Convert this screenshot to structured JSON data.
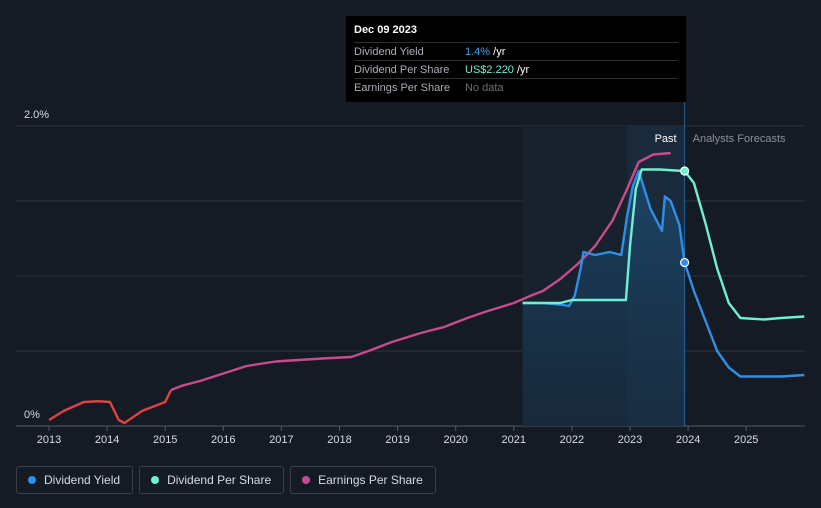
{
  "tooltip": {
    "date": "Dec 09 2023",
    "rows": [
      {
        "label": "Dividend Yield",
        "value": "1.4%",
        "unit": " /yr"
      },
      {
        "label": "Dividend Per Share",
        "value": "US$2.220",
        "unit": " /yr"
      },
      {
        "label": "Earnings Per Share",
        "value": "No data",
        "unit": ""
      }
    ]
  },
  "legend": [
    {
      "label": "Dividend Yield",
      "color": "#2f8fe6"
    },
    {
      "label": "Dividend Per Share",
      "color": "#6ff0d2"
    },
    {
      "label": "Earnings Per Share",
      "color": "#c94b8f"
    }
  ],
  "chart_data": {
    "type": "line",
    "y_tick_labels": [
      "2.0%",
      "0%"
    ],
    "x_tick_labels": [
      "2013",
      "2014",
      "2015",
      "2016",
      "2017",
      "2018",
      "2019",
      "2020",
      "2021",
      "2022",
      "2023",
      "2024",
      "2025"
    ],
    "past_label": "Past",
    "forecast_label": "Analysts Forecasts",
    "ylim": [
      0,
      2.0
    ],
    "xlim": [
      2012.55,
      2026.0
    ],
    "grid": true,
    "past_region": [
      2021.15,
      2023.94
    ],
    "highlight_region": [
      2022.95,
      2023.94
    ],
    "cursor_x": 2023.94,
    "colors": {
      "yield": "#2f8fe6",
      "dps": "#6ff0d2",
      "eps": "#c94b8f",
      "eps_early": "#e0433f",
      "forecast_dps": "#6ff0d2"
    },
    "series": [
      {
        "name": "Earnings Per Share",
        "role": "eps",
        "x": [
          2013.0,
          2013.25,
          2013.6,
          2013.85,
          2014.05,
          2014.2,
          2014.3,
          2014.6,
          2014.8,
          2015.0,
          2015.1,
          2015.3,
          2015.6,
          2016.0,
          2016.4,
          2016.9,
          2017.3,
          2017.7,
          2018.2,
          2018.5,
          2018.9,
          2019.4,
          2019.8,
          2020.2,
          2020.5,
          2020.75,
          2021.0,
          2021.3,
          2021.5,
          2021.8,
          2022.1,
          2022.4,
          2022.7,
          2022.95,
          2023.15,
          2023.4,
          2023.7
        ],
        "y": [
          0.04,
          0.1,
          0.16,
          0.165,
          0.16,
          0.04,
          0.02,
          0.1,
          0.13,
          0.16,
          0.24,
          0.27,
          0.3,
          0.35,
          0.4,
          0.43,
          0.44,
          0.45,
          0.46,
          0.5,
          0.56,
          0.62,
          0.66,
          0.72,
          0.76,
          0.79,
          0.82,
          0.87,
          0.9,
          0.98,
          1.08,
          1.2,
          1.37,
          1.58,
          1.76,
          1.81,
          1.82
        ]
      },
      {
        "name": "Dividend Per Share",
        "role": "dps",
        "x": [
          2021.15,
          2021.5,
          2021.8,
          2022.0,
          2022.4,
          2022.8,
          2022.93,
          2023.0,
          2023.1,
          2023.2,
          2023.5,
          2023.94
        ],
        "y": [
          0.82,
          0.82,
          0.82,
          0.84,
          0.84,
          0.84,
          0.84,
          1.2,
          1.58,
          1.71,
          1.71,
          1.7
        ]
      },
      {
        "name": "Dividend Yield",
        "role": "yield",
        "x": [
          2021.15,
          2021.5,
          2021.8,
          2021.95,
          2022.05,
          2022.15,
          2022.2,
          2022.4,
          2022.65,
          2022.85,
          2022.95,
          2023.05,
          2023.15,
          2023.35,
          2023.55,
          2023.6,
          2023.7,
          2023.85,
          2023.94
        ],
        "y": [
          0.82,
          0.82,
          0.81,
          0.8,
          0.87,
          1.05,
          1.16,
          1.14,
          1.16,
          1.14,
          1.4,
          1.6,
          1.7,
          1.45,
          1.3,
          1.53,
          1.5,
          1.34,
          1.09
        ]
      },
      {
        "name": "Dividend Per Share Forecast",
        "role": "dps_forecast",
        "x": [
          2023.94,
          2024.1,
          2024.3,
          2024.5,
          2024.7,
          2024.9,
          2025.3,
          2025.6,
          2026.0
        ],
        "y": [
          1.7,
          1.62,
          1.35,
          1.05,
          0.82,
          0.72,
          0.71,
          0.72,
          0.73
        ]
      },
      {
        "name": "Dividend Yield Forecast",
        "role": "yield_forecast",
        "x": [
          2023.94,
          2024.1,
          2024.3,
          2024.5,
          2024.7,
          2024.9,
          2025.3,
          2025.6,
          2026.0
        ],
        "y": [
          1.09,
          0.9,
          0.7,
          0.5,
          0.39,
          0.33,
          0.33,
          0.33,
          0.34
        ]
      }
    ],
    "markers": [
      {
        "x": 2023.94,
        "y": 1.7,
        "role": "dps"
      },
      {
        "x": 2023.94,
        "y": 1.09,
        "role": "yield"
      }
    ]
  }
}
